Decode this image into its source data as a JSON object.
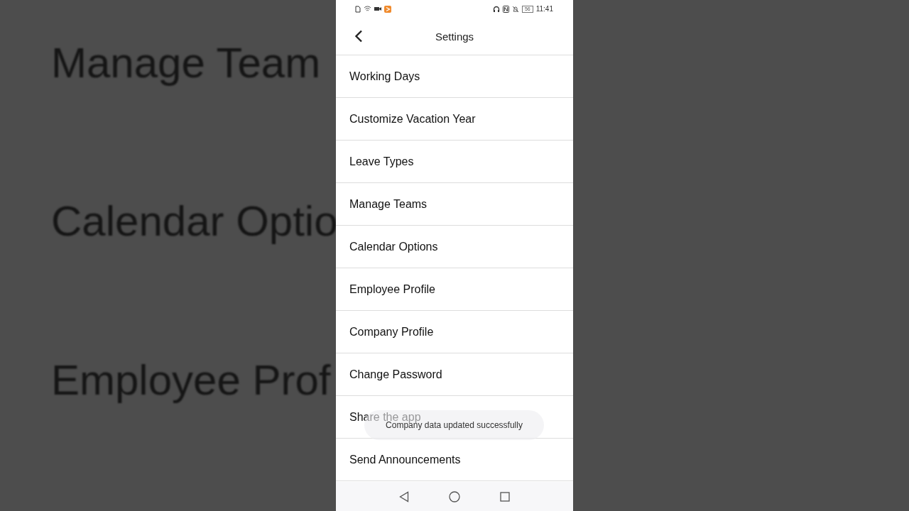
{
  "backdrop": [
    "Manage Team",
    "Calendar Optio",
    "Employee Prof"
  ],
  "status_bar": {
    "battery": "56",
    "time": "11:41"
  },
  "header": {
    "title": "Settings"
  },
  "items": [
    "Working Days",
    "Customize Vacation Year",
    "Leave Types",
    "Manage Teams",
    "Calendar Options",
    "Employee Profile",
    "Company Profile",
    "Change Password",
    "Share the app",
    "Send Announcements"
  ],
  "toast": {
    "message": "Company data updated successfully"
  }
}
